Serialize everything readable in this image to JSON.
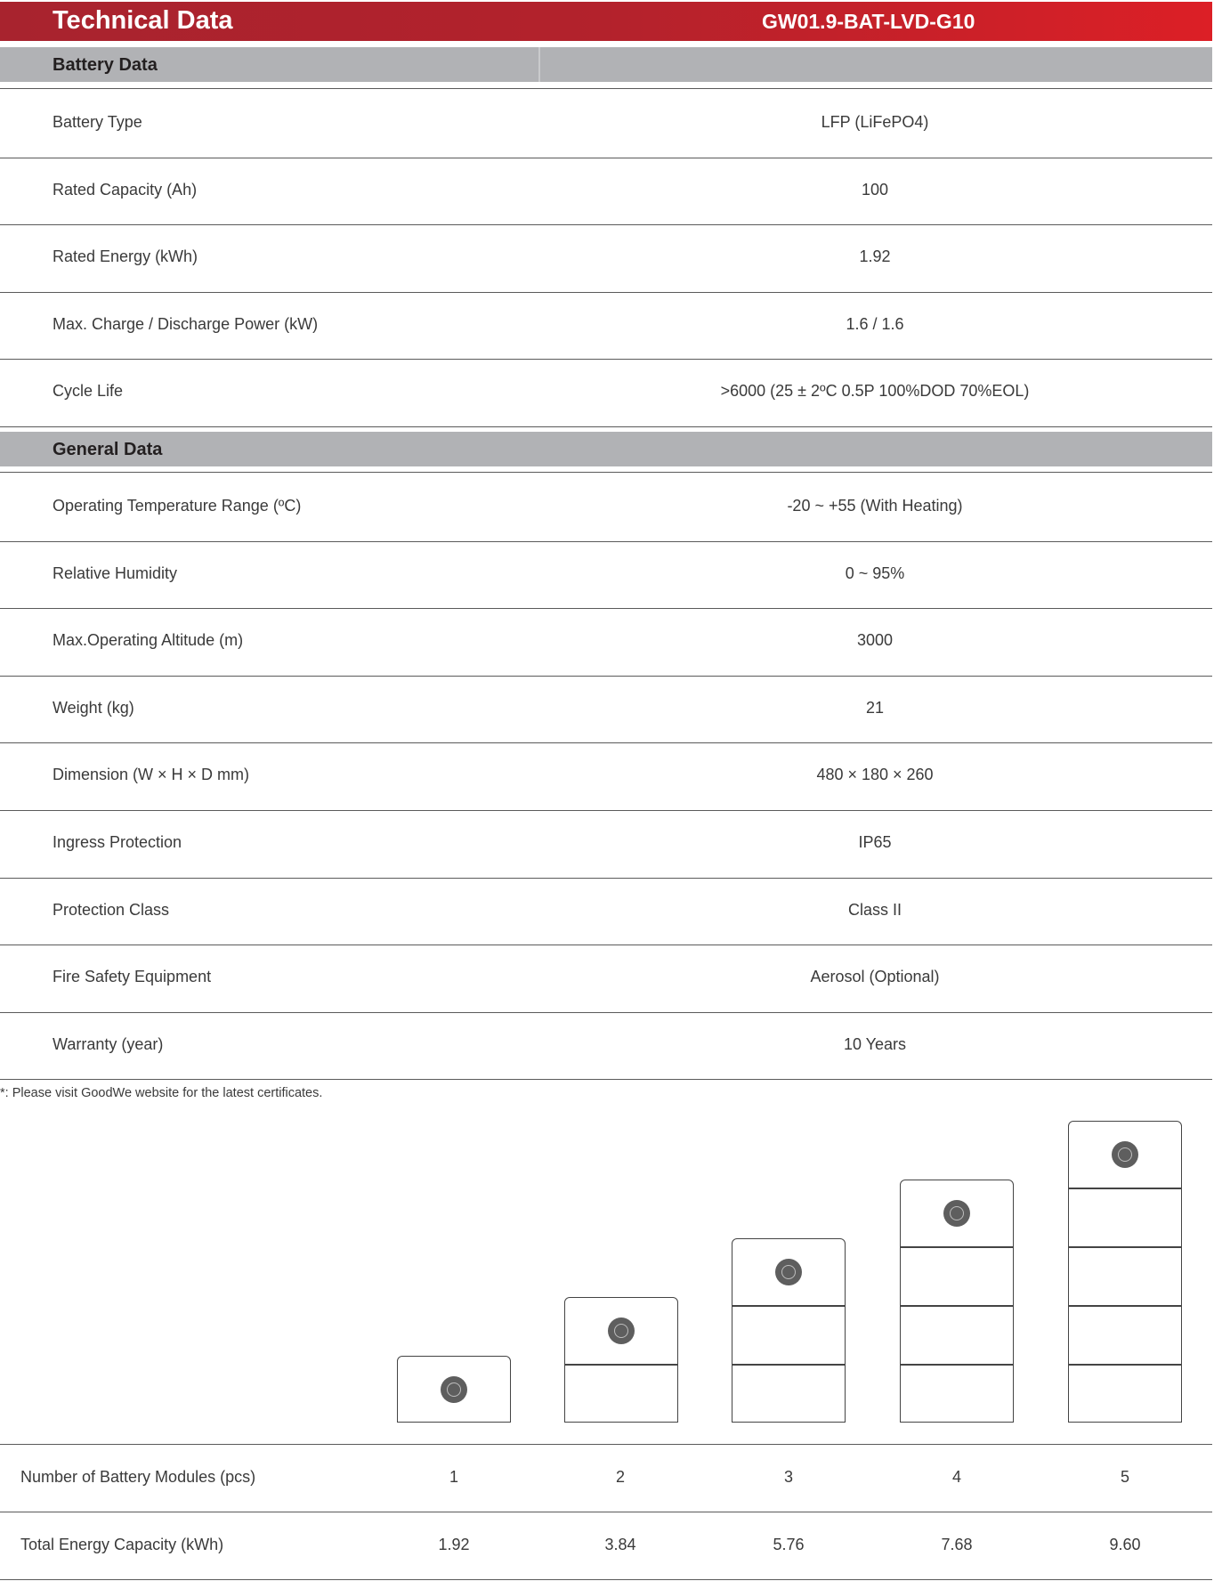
{
  "header": {
    "title": "Technical Data",
    "model": "GW01.9-BAT-LVD-G10",
    "gradient_start": "#a8232e",
    "gradient_end": "#dc1f26"
  },
  "battery_section": {
    "title": "Battery Data",
    "rows": [
      {
        "label": "Battery Type",
        "value": "LFP (LiFePO4)"
      },
      {
        "label": "Rated Capacity (Ah)",
        "value": "100"
      },
      {
        "label": "Rated Energy (kWh)",
        "value": "1.92"
      },
      {
        "label": "Max. Charge / Discharge Power (kW)",
        "value": "1.6 / 1.6"
      },
      {
        "label": "Cycle Life",
        "value": ">6000 (25 ± 2ºC 0.5P 100%DOD 70%EOL)"
      }
    ]
  },
  "general_section": {
    "title": "General Data",
    "rows": [
      {
        "label": "Operating Temperature Range (ºC)",
        "value": "-20 ~ +55 (With Heating)"
      },
      {
        "label": "Relative Humidity",
        "value": "0 ~ 95%"
      },
      {
        "label": "Max.Operating Altitude (m)",
        "value": "3000"
      },
      {
        "label": "Weight (kg)",
        "value": "21"
      },
      {
        "label": "Dimension (W × H × D mm)",
        "value": "480 × 180 × 260"
      },
      {
        "label": "Ingress Protection",
        "value": "IP65"
      },
      {
        "label": "Protection Class",
        "value": "Class II"
      },
      {
        "label": "Fire Safety Equipment",
        "value": "Aerosol (Optional)"
      },
      {
        "label": "Warranty (year)",
        "value": "10 Years"
      }
    ]
  },
  "footnote": "*: Please visit GoodWe website for the latest certificates.",
  "stacking": {
    "modules_label": "Number of Battery Modules (pcs)",
    "modules": [
      "1",
      "2",
      "3",
      "4",
      "5"
    ],
    "energy_label": "Total Energy Capacity (kWh)",
    "energy": [
      "1.92",
      "3.84",
      "5.76",
      "7.68",
      "9.60"
    ]
  }
}
